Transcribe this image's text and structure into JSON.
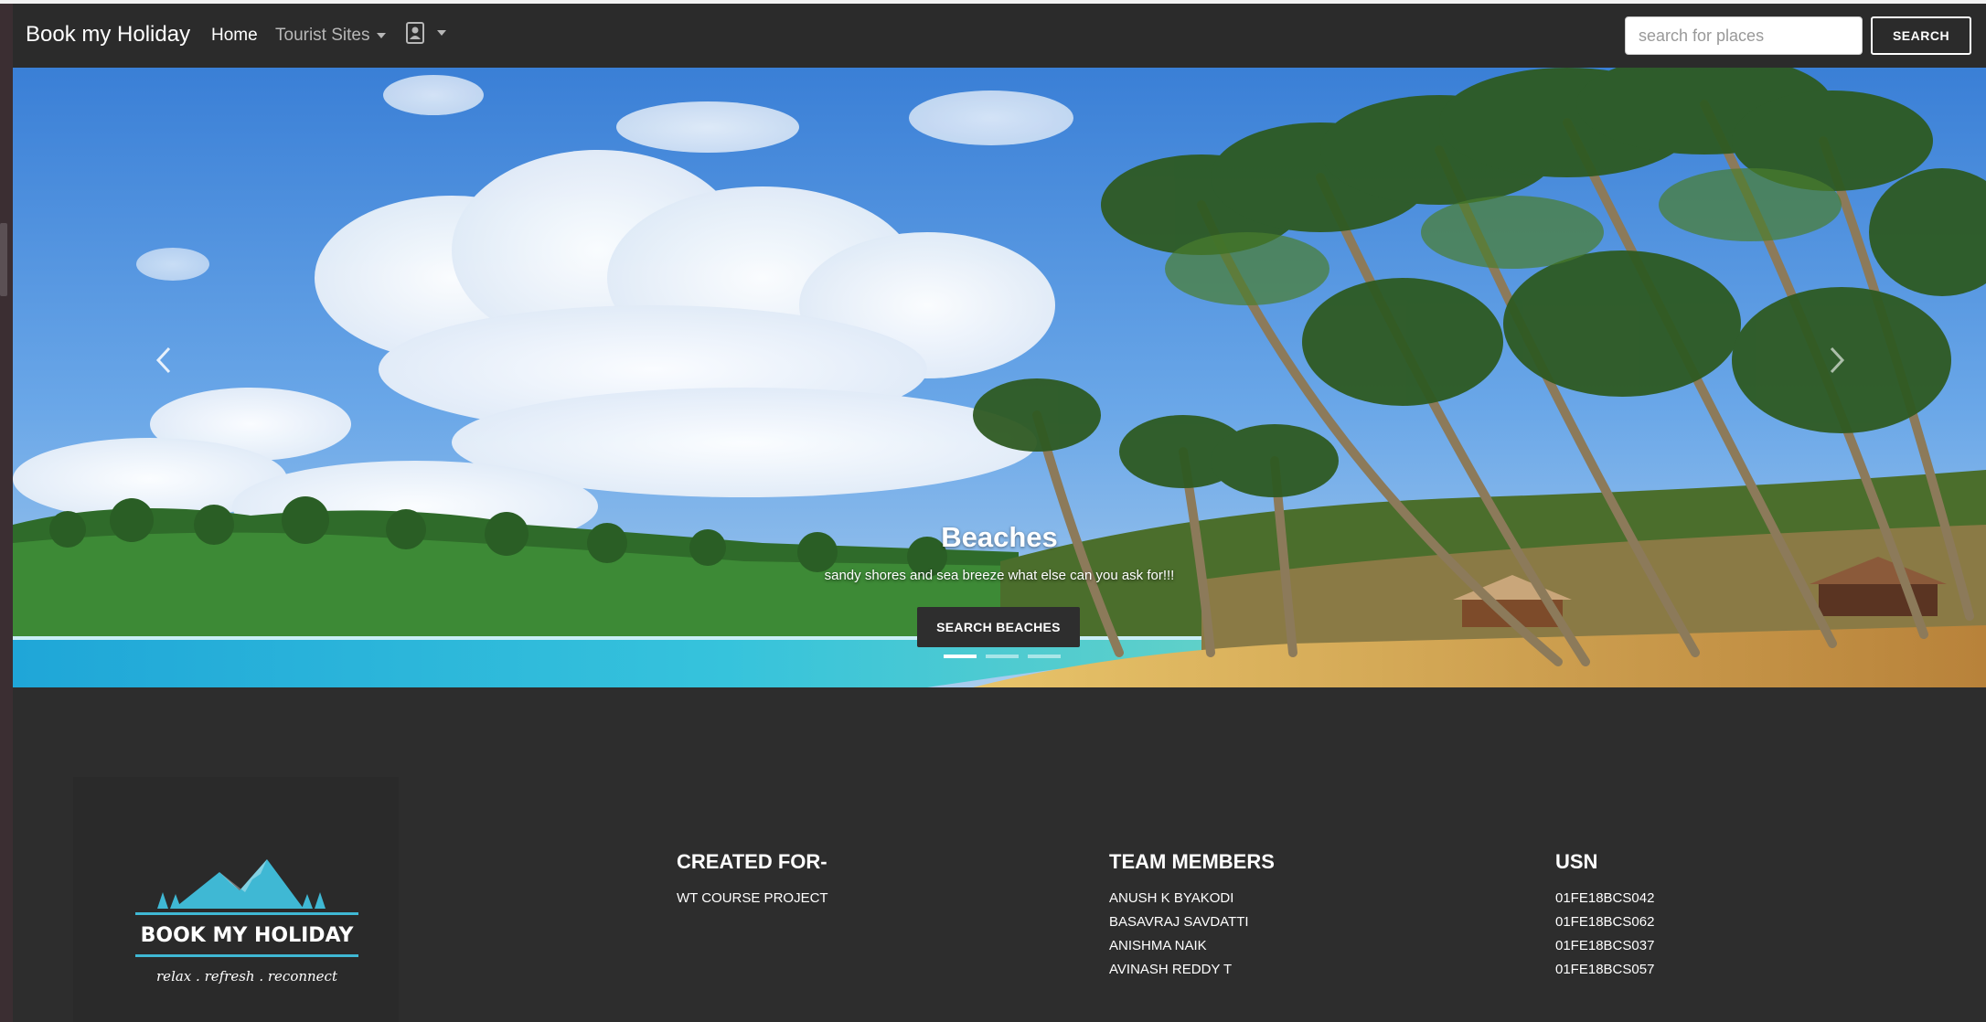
{
  "navbar": {
    "brand": "Book my Holiday",
    "home": "Home",
    "tourist_sites": "Tourist Sites",
    "search_placeholder": "search for places",
    "search_button": "SEARCH"
  },
  "carousel": {
    "slide_title": "Beaches",
    "slide_text": "sandy shores and sea breeze what else can you ask for!!!",
    "slide_button": "SEARCH BEACHES",
    "indicator_count": 3,
    "active_index": 0
  },
  "footer": {
    "logo": {
      "title": "BOOK MY HOLIDAY",
      "tagline": "relax . refresh . reconnect"
    },
    "created_for": {
      "title": "CREATED FOR-",
      "lines": [
        "WT COURSE PROJECT"
      ]
    },
    "team": {
      "title": "TEAM MEMBERS",
      "members": [
        "ANUSH K BYAKODI",
        "BASAVRAJ SAVDATTI",
        "ANISHMA NAIK",
        "AVINASH REDDY T"
      ]
    },
    "usn": {
      "title": "USN",
      "values": [
        "01FE18BCS042",
        "01FE18BCS062",
        "01FE18BCS037",
        "01FE18BCS057"
      ]
    }
  },
  "colors": {
    "navbar_bg": "#2b2b2b",
    "footer_bg": "#2d2d2d",
    "logo_accent": "#3fb8d4"
  },
  "icons": [
    "user-account-icon",
    "chevron-left-icon",
    "chevron-right-icon",
    "mountain-logo-icon"
  ]
}
